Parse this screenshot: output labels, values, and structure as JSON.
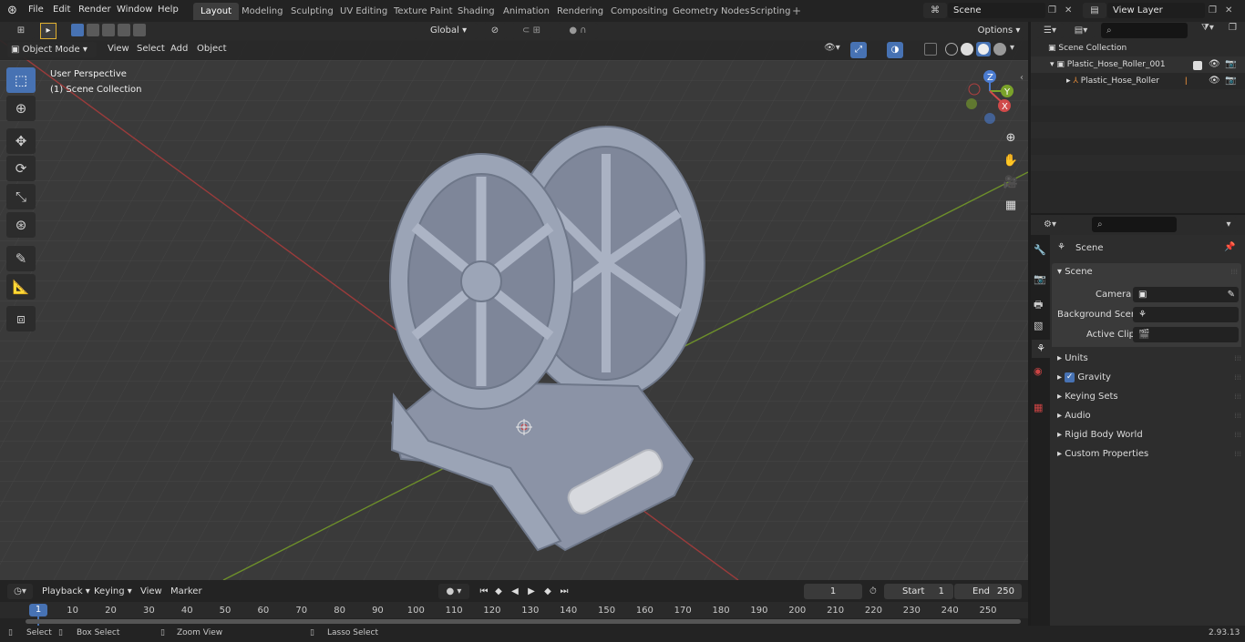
{
  "menu": {
    "file": "File",
    "edit": "Edit",
    "render": "Render",
    "window": "Window",
    "help": "Help"
  },
  "workspaces": [
    "Layout",
    "Modeling",
    "Sculpting",
    "UV Editing",
    "Texture Paint",
    "Shading",
    "Animation",
    "Rendering",
    "Compositing",
    "Geometry Nodes",
    "Scripting"
  ],
  "scene_name": "Scene",
  "view_layer": "View Layer",
  "viewport": {
    "mode": "Object Mode",
    "menus": [
      "View",
      "Select",
      "Add",
      "Object"
    ],
    "orientation": "Global",
    "options": "Options",
    "perspective": "User Perspective",
    "collection": "(1) Scene Collection"
  },
  "gizmo": {
    "x": "X",
    "y": "Y",
    "z": "Z"
  },
  "outliner": {
    "root": "Scene Collection",
    "collection": "Plastic_Hose_Roller_001",
    "object": "Plastic_Hose_Roller"
  },
  "properties": {
    "context": "Scene",
    "panel": "Scene",
    "camera_label": "Camera",
    "bg_label": "Background Scene",
    "clip_label": "Active Clip",
    "sections": [
      "Units",
      "Gravity",
      "Keying Sets",
      "Audio",
      "Rigid Body World",
      "Custom Properties"
    ]
  },
  "timeline": {
    "playback": "Playback",
    "keying": "Keying",
    "view": "View",
    "marker": "Marker",
    "current_frame": "1",
    "start_label": "Start",
    "start": "1",
    "end_label": "End",
    "end": "250",
    "current_marker": "1",
    "ticks": [
      "10",
      "20",
      "30",
      "40",
      "50",
      "60",
      "70",
      "80",
      "90",
      "100",
      "110",
      "120",
      "130",
      "140",
      "150",
      "160",
      "170",
      "180",
      "190",
      "200",
      "210",
      "220",
      "230",
      "240",
      "250"
    ]
  },
  "status": {
    "select": "Select",
    "box": "Box Select",
    "zoom": "Zoom View",
    "lasso": "Lasso Select",
    "version": "2.93.13"
  },
  "colors": {
    "accent": "#4772b3",
    "x_axis": "#9b3b3b",
    "y_axis": "#6d8f2a"
  }
}
